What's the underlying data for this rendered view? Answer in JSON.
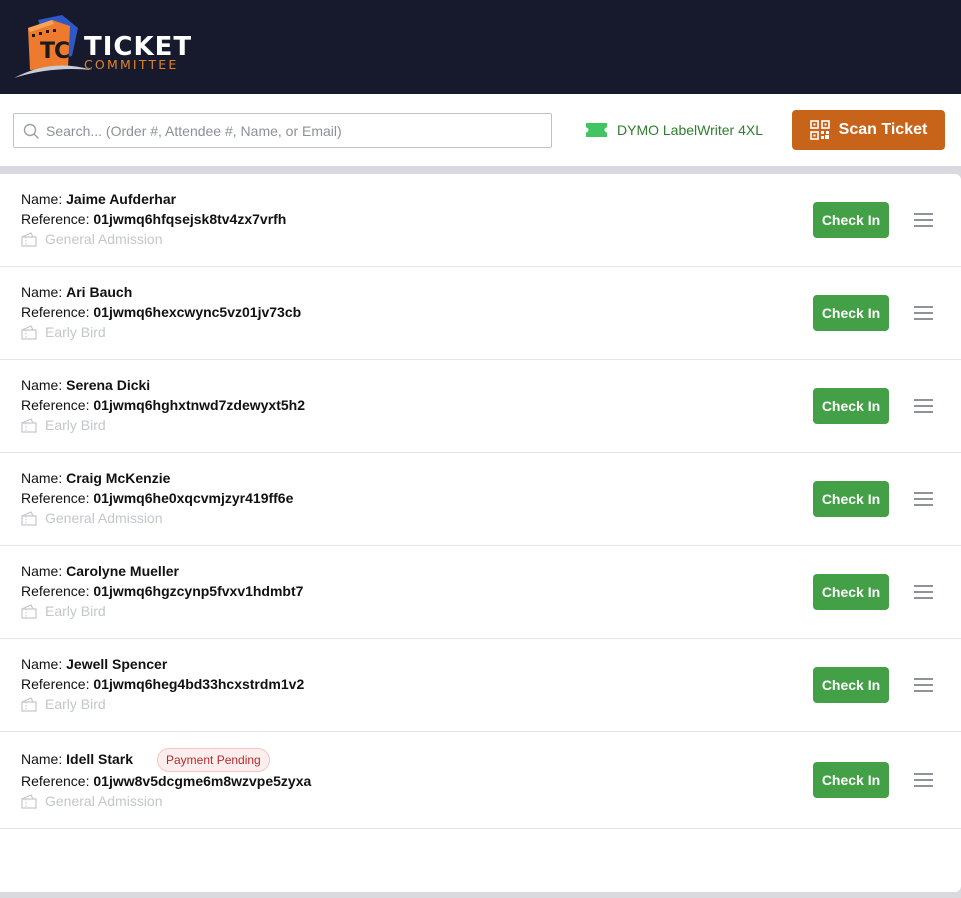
{
  "brand": {
    "line1": "TICKET",
    "line2": "COMMITTEE",
    "logo_letters": "TC",
    "colors": {
      "orange": "#e8732a",
      "navy": "#161a2c",
      "blue": "#2e58c7"
    }
  },
  "search": {
    "placeholder": "Search... (Order #, Attendee #, Name, or Email)",
    "value": ""
  },
  "printer": {
    "label": "DYMO LabelWriter 4XL",
    "icon": "ticket-icon",
    "color": "#43c463"
  },
  "scan_button": {
    "label": "Scan Ticket",
    "icon": "qr-code-icon",
    "color": "#c8631a"
  },
  "labels": {
    "name": "Name:",
    "reference": "Reference:",
    "checkin": "Check In"
  },
  "attendees": [
    {
      "name": "Jaime Aufderhar",
      "reference": "01jwmq6hfqsejsk8tv4zx7vrfh",
      "ticket_type": "General Admission",
      "badge": ""
    },
    {
      "name": "Ari Bauch",
      "reference": "01jwmq6hexcwync5vz01jv73cb",
      "ticket_type": "Early Bird",
      "badge": ""
    },
    {
      "name": "Serena Dicki",
      "reference": "01jwmq6hghxtnwd7zdewyxt5h2",
      "ticket_type": "Early Bird",
      "badge": ""
    },
    {
      "name": "Craig McKenzie",
      "reference": "01jwmq6he0xqcvmjzyr419ff6e",
      "ticket_type": "General Admission",
      "badge": ""
    },
    {
      "name": "Carolyne Mueller",
      "reference": "01jwmq6hgzcynp5fvxv1hdmbt7",
      "ticket_type": "Early Bird",
      "badge": ""
    },
    {
      "name": "Jewell Spencer",
      "reference": "01jwmq6heg4bd33hcxstrdm1v2",
      "ticket_type": "Early Bird",
      "badge": ""
    },
    {
      "name": "Idell Stark",
      "reference": "01jww8v5dcgme6m8wzvpe5zyxa",
      "ticket_type": "General Admission",
      "badge": "Payment Pending"
    }
  ]
}
